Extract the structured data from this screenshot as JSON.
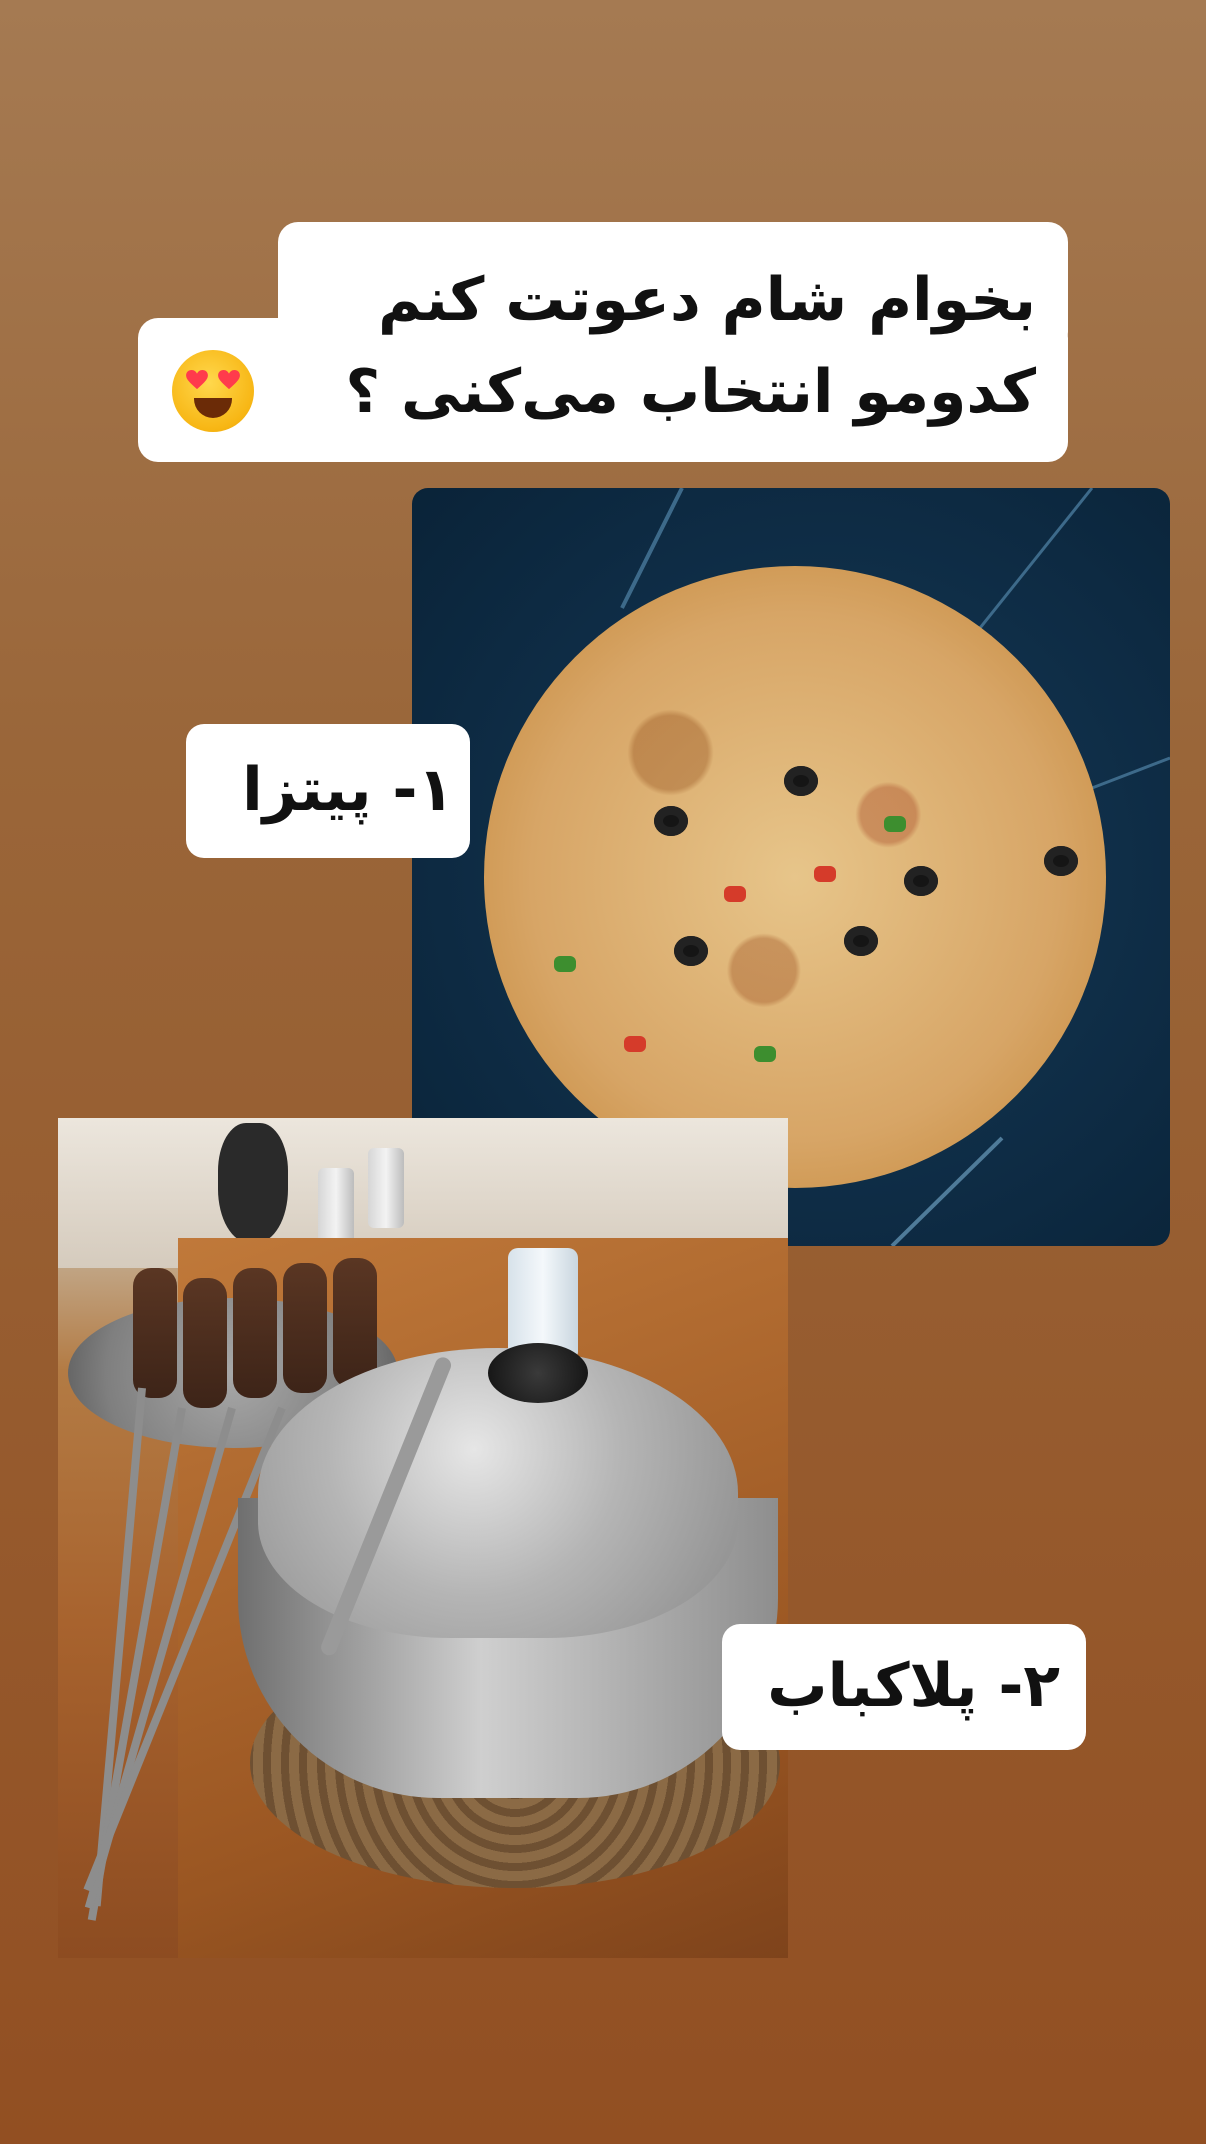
{
  "heading": {
    "line1": "بخوام شام دعوتت کنم",
    "line2": "کدومو انتخاب می‌کنی ؟"
  },
  "emoji": "heart-eyes-emoji",
  "options": [
    {
      "label": "۱- پیتزا",
      "image": "pizza-photo"
    },
    {
      "label": "۲- پلاکباب",
      "image": "kebab-photo"
    }
  ],
  "colors": {
    "background_top": "#a57a52",
    "background_bottom": "#924f22",
    "card": "#ffffff",
    "text": "#111111"
  }
}
